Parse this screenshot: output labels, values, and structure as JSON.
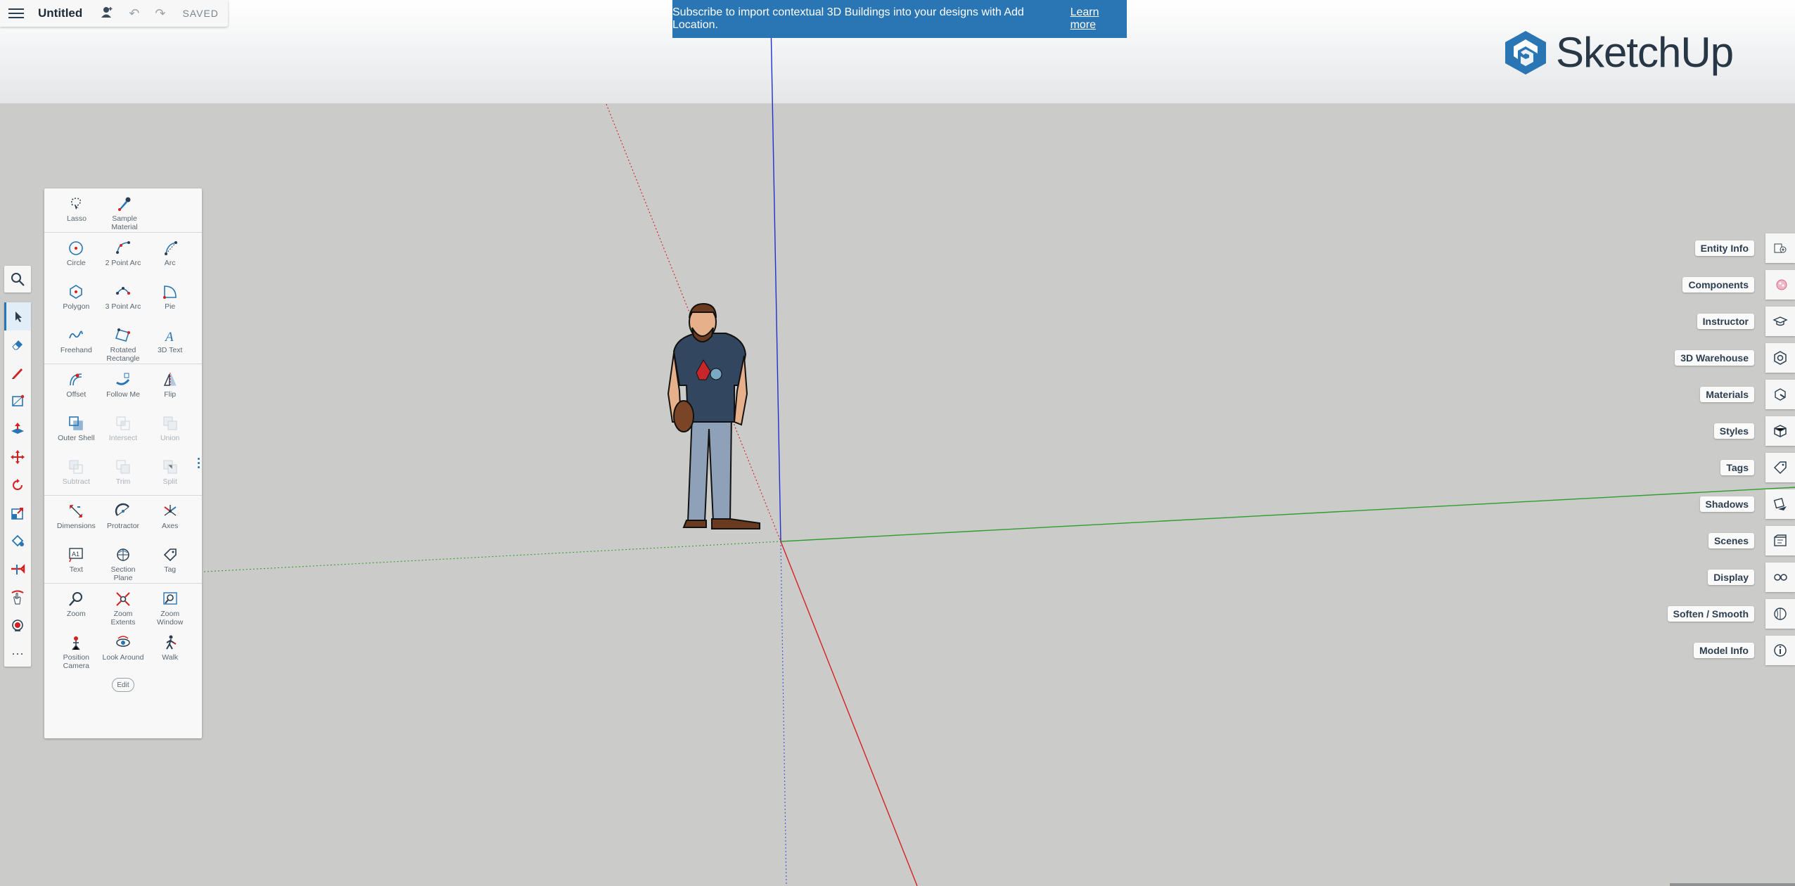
{
  "topbar": {
    "title": "Untitled",
    "status": "SAVED"
  },
  "banner": {
    "text": "Subscribe to import contextual 3D Buildings into your designs with Add Location.",
    "link": "Learn more"
  },
  "logo": {
    "text": "SketchUp",
    "color": "#2a75b3"
  },
  "panel": {
    "groups": [
      [
        {
          "label": "Lasso",
          "icon": "lasso-icon"
        },
        {
          "label": "Sample\nMaterial",
          "icon": "eyedropper-icon"
        }
      ],
      [
        {
          "label": "Circle",
          "icon": "circle-icon"
        },
        {
          "label": "2 Point Arc",
          "icon": "two-point-arc-icon"
        },
        {
          "label": "Arc",
          "icon": "arc-icon"
        },
        {
          "label": "Polygon",
          "icon": "polygon-icon"
        },
        {
          "label": "3 Point Arc",
          "icon": "three-point-arc-icon"
        },
        {
          "label": "Pie",
          "icon": "pie-icon"
        },
        {
          "label": "Freehand",
          "icon": "freehand-icon"
        },
        {
          "label": "Rotated\nRectangle",
          "icon": "rotated-rectangle-icon"
        },
        {
          "label": "3D Text",
          "icon": "three-d-text-icon"
        }
      ],
      [
        {
          "label": "Offset",
          "icon": "offset-icon"
        },
        {
          "label": "Follow Me",
          "icon": "follow-me-icon"
        },
        {
          "label": "Flip",
          "icon": "flip-icon"
        },
        {
          "label": "Outer Shell",
          "icon": "outer-shell-icon"
        },
        {
          "label": "Intersect",
          "icon": "intersect-icon",
          "disabled": true
        },
        {
          "label": "Union",
          "icon": "union-icon",
          "disabled": true
        },
        {
          "label": "Subtract",
          "icon": "subtract-icon",
          "disabled": true
        },
        {
          "label": "Trim",
          "icon": "trim-icon",
          "disabled": true
        },
        {
          "label": "Split",
          "icon": "split-icon",
          "disabled": true
        }
      ],
      [
        {
          "label": "Dimensions",
          "icon": "dimensions-icon"
        },
        {
          "label": "Protractor",
          "icon": "protractor-icon"
        },
        {
          "label": "Axes",
          "icon": "axes-icon"
        },
        {
          "label": "Text",
          "icon": "text-icon"
        },
        {
          "label": "Section\nPlane",
          "icon": "section-plane-icon"
        },
        {
          "label": "Tag",
          "icon": "tag-icon"
        }
      ],
      [
        {
          "label": "Zoom",
          "icon": "zoom-icon"
        },
        {
          "label": "Zoom\nExtents",
          "icon": "zoom-extents-icon"
        },
        {
          "label": "Zoom\nWindow",
          "icon": "zoom-window-icon"
        },
        {
          "label": "Position\nCamera",
          "icon": "position-camera-icon"
        },
        {
          "label": "Look Around",
          "icon": "look-around-icon"
        },
        {
          "label": "Walk",
          "icon": "walk-icon"
        }
      ]
    ],
    "edit_label": "Edit"
  },
  "right_panels": [
    {
      "label": "Entity Info",
      "icon": "entity-info-icon"
    },
    {
      "label": "Components",
      "icon": "components-icon"
    },
    {
      "label": "Instructor",
      "icon": "instructor-icon"
    },
    {
      "label": "3D Warehouse",
      "icon": "warehouse-icon"
    },
    {
      "label": "Materials",
      "icon": "materials-icon"
    },
    {
      "label": "Styles",
      "icon": "styles-icon"
    },
    {
      "label": "Tags",
      "icon": "tags-icon"
    },
    {
      "label": "Shadows",
      "icon": "shadows-icon"
    },
    {
      "label": "Scenes",
      "icon": "scenes-icon"
    },
    {
      "label": "Display",
      "icon": "display-icon"
    },
    {
      "label": "Soften / Smooth",
      "icon": "soften-smooth-icon"
    },
    {
      "label": "Model Info",
      "icon": "model-info-icon"
    }
  ],
  "colors": {
    "blue_axis": "#1f2fd0",
    "green_axis": "#2f9d2f",
    "red_axis": "#d42020",
    "accent": "#2a75b3"
  }
}
